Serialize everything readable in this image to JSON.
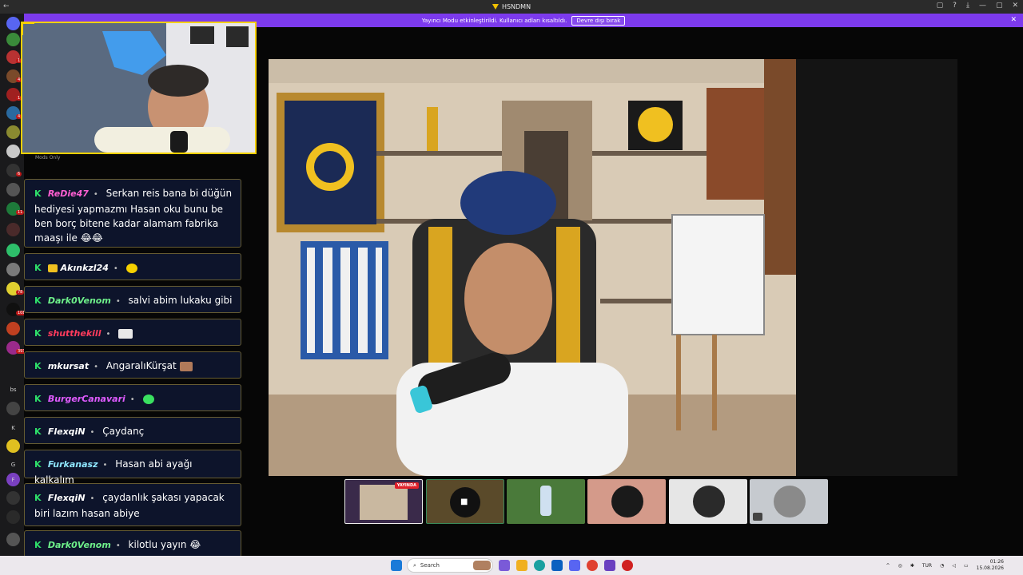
{
  "window": {
    "title": "HSNDMN",
    "controls": [
      "▢",
      "?",
      "⤓",
      "—",
      "▢",
      "✕"
    ]
  },
  "banner": {
    "message": "Yayıncı Modu etkinleştirildi. Kullanıcı adları kısaltıldı.",
    "button_label": "Devre dışı bırak",
    "close": "✕"
  },
  "sidebar": {
    "badges": [
      "1",
      "4",
      "1",
      "4",
      "6",
      "11",
      "78",
      "108",
      "393"
    ],
    "letters": [
      "bs",
      "K",
      "G",
      "F"
    ]
  },
  "chat": {
    "mods_only_label": "Mods Only",
    "messages": [
      {
        "user": "ReDie47",
        "user_color": "#ff5fd2",
        "text": "Serkan reis bana bi düğün hediyesi yapmazmı Hasan oku bunu be ben borç bitene kadar alamam fabrika maaşı ile",
        "emotes": "😂😂"
      },
      {
        "user": "Akınkzl24",
        "user_color": "#ffffff",
        "text": "",
        "emotes": "yellow"
      },
      {
        "user": "Dark0Venom",
        "user_color": "#6ef08a",
        "text": "salvi abim lukaku gibi",
        "emotes": ""
      },
      {
        "user": "shutthekill",
        "user_color": "#ff3b5c",
        "text": "",
        "emotes": "meme"
      },
      {
        "user": "mkursat",
        "user_color": "#ffffff",
        "text": "AngaralıKürşat",
        "emotes": "face"
      },
      {
        "user": "BurgerCanavari",
        "user_color": "#e05bff",
        "text": "",
        "emotes": "green"
      },
      {
        "user": "FlexqiN",
        "user_color": "#ffffff",
        "text": "Çaydanç",
        "emotes": ""
      },
      {
        "user": "Furkanasz",
        "user_color": "#8fe6ff",
        "text": "Hasan abi ayağı kalkalım",
        "emotes": ""
      },
      {
        "user": "FlexqiN",
        "user_color": "#ffffff",
        "text": "çaydanlık şakası yapacak biri lazım hasan abiye",
        "emotes": ""
      },
      {
        "user": "Dark0Venom",
        "user_color": "#6ef08a",
        "text": "kilotlu yayın",
        "emotes": "😂"
      }
    ]
  },
  "participants": {
    "live_label": "YAYINDA"
  },
  "taskbar": {
    "search_placeholder": "Search",
    "language": "TUR",
    "time": "01:26",
    "date": "15.08.2026"
  },
  "colors": {
    "banner": "#7c3aed",
    "webcam_border": "#f5d000",
    "chat_bg": "#0e162e",
    "kick_green": "#2ee06a"
  }
}
